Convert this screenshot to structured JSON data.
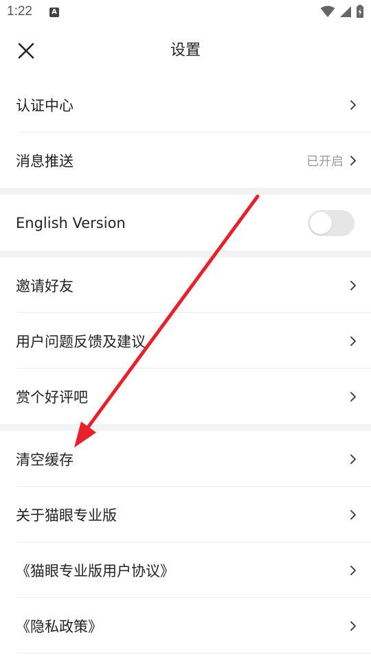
{
  "status_bar": {
    "time": "1:22",
    "notification_icon": "A",
    "icons": [
      "wifi-icon",
      "signal-icon",
      "battery-icon"
    ]
  },
  "header": {
    "title": "设置",
    "close_icon": "close-icon"
  },
  "sections": {
    "s1": {
      "verification": {
        "label": "认证中心"
      },
      "push": {
        "label": "消息推送",
        "value": "已开启"
      }
    },
    "s2": {
      "english": {
        "label": "English Version",
        "toggle_on": false
      }
    },
    "s3": {
      "invite": {
        "label": "邀请好友"
      },
      "feedback": {
        "label": "用户问题反馈及建议"
      },
      "rate": {
        "label": "赏个好评吧"
      }
    },
    "s4": {
      "clear_cache": {
        "label": "清空缓存"
      },
      "about": {
        "label": "关于猫眼专业版"
      },
      "agreement": {
        "label": "《猫眼专业版用户协议》"
      },
      "privacy": {
        "label": "《隐私政策》"
      }
    }
  },
  "annotation": {
    "color": "#e8202a"
  },
  "colors": {
    "divider": "#ececec",
    "section_gap": "#f2f2f2",
    "secondary_text": "#9a9a9a",
    "toggle_off": "#e6e6e6"
  }
}
